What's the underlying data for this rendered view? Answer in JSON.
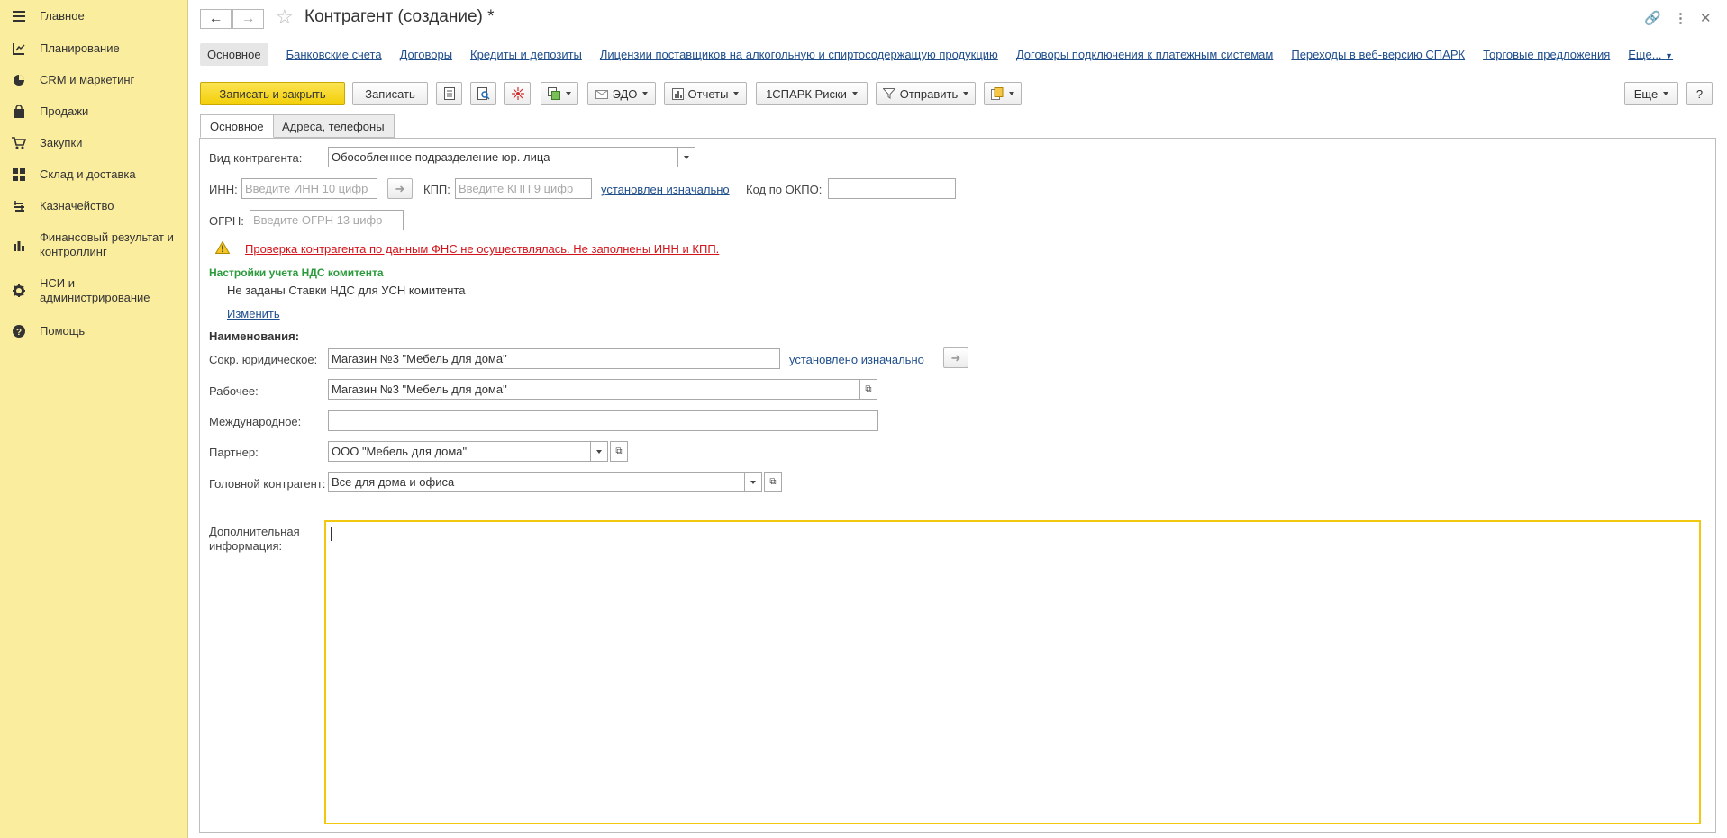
{
  "sidebar": {
    "items": [
      {
        "label": "Главное",
        "icon": "menu-icon"
      },
      {
        "label": "Планирование",
        "icon": "planning-icon"
      },
      {
        "label": "CRM и маркетинг",
        "icon": "pie-chart-icon"
      },
      {
        "label": "Продажи",
        "icon": "bag-icon"
      },
      {
        "label": "Закупки",
        "icon": "cart-icon"
      },
      {
        "label": "Склад и доставка",
        "icon": "grid-icon"
      },
      {
        "label": "Казначейство",
        "icon": "treasury-icon"
      },
      {
        "label": "Финансовый результат и контроллинг",
        "icon": "bar-chart-icon"
      },
      {
        "label": "НСИ и администрирование",
        "icon": "gear-icon"
      },
      {
        "label": "Помощь",
        "icon": "help-icon"
      }
    ]
  },
  "header": {
    "title": "Контрагент (создание) *"
  },
  "link_panel": {
    "active": "Основное",
    "links": [
      "Банковские счета",
      "Договоры",
      "Кредиты и депозиты",
      "Лицензии поставщиков на алкогольную и спиртосодержащую продукцию",
      "Договоры подключения к платежным системам",
      "Переходы в веб-версию СПАРК",
      "Торговые предложения",
      "Еще..."
    ]
  },
  "toolbar": {
    "save_close": "Записать и закрыть",
    "save": "Записать",
    "edo": "ЭДО",
    "reports": "Отчеты",
    "spark": "1СПАРК Риски",
    "send": "Отправить",
    "more": "Еще",
    "help": "?"
  },
  "tabs": {
    "main": "Основное",
    "addresses": "Адреса, телефоны"
  },
  "form": {
    "kind_label": "Вид контрагента:",
    "kind_value": "Обособленное подразделение юр. лица",
    "inn_label": "ИНН:",
    "inn_placeholder": "Введите ИНН 10 цифр",
    "kpp_label": "КПП:",
    "kpp_placeholder": "Введите КПП 9 цифр",
    "kpp_link": "установлен изначально",
    "okpo_label": "Код по ОКПО:",
    "okpo_value": "",
    "ogrn_label": "ОГРН:",
    "ogrn_placeholder": "Введите ОГРН 13 цифр",
    "fns_warning": "Проверка контрагента по данным ФНС не осуществлялась. Не заполнены ИНН и КПП.",
    "vat_header": "Настройки учета НДС комитента",
    "vat_text": "Не заданы Ставки НДС для УСН комитента",
    "vat_change": "Изменить",
    "names_header": "Наименования:",
    "short_label": "Сокр. юридическое:",
    "short_value": "Магазин №3 \"Мебель для дома\"",
    "short_link": "установлено изначально",
    "work_label": "Рабочее:",
    "work_value": "Магазин №3 \"Мебель для дома\"",
    "intl_label": "Международное:",
    "intl_value": "",
    "partner_label": "Партнер:",
    "partner_value": "ООО \"Мебель для дома\"",
    "head_label": "Головной контрагент:",
    "head_value": "Все для дома и офиса",
    "notes_label": "Дополнительная информация:"
  },
  "colors": {
    "sidebar_bg": "#fbed9e",
    "primary_button": "#f3cf08",
    "link": "#1f4e8c",
    "warning": "#d3141b",
    "section_green": "#2a9a3a"
  }
}
